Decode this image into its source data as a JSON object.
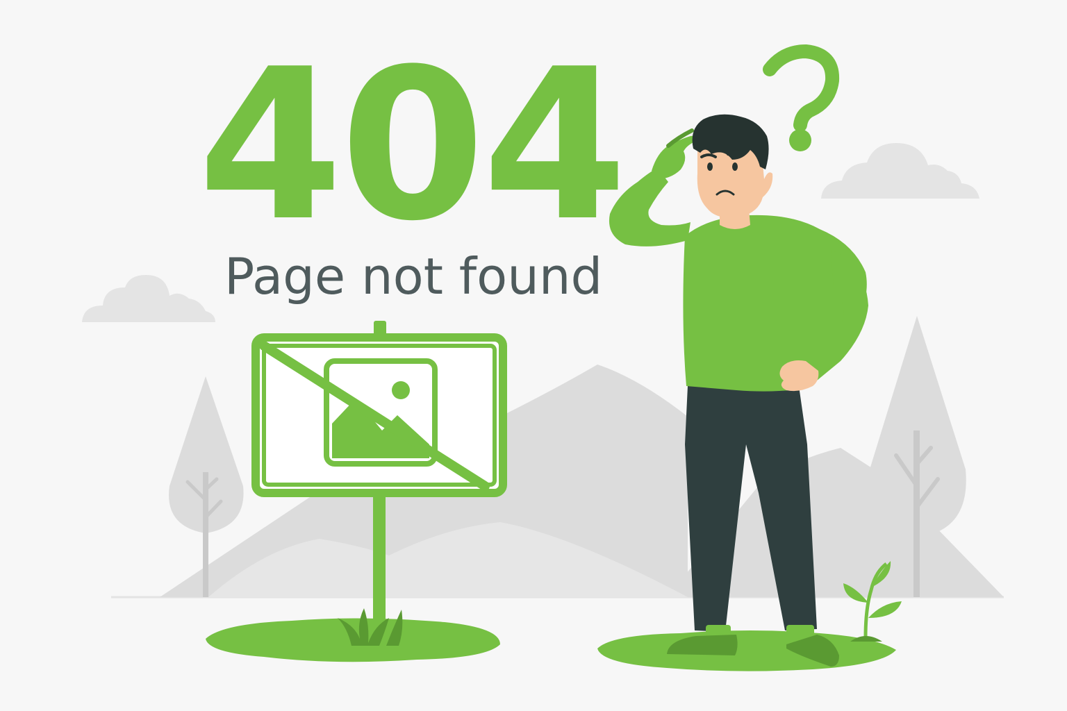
{
  "error": {
    "code": "404",
    "message": "Page not found"
  },
  "colors": {
    "accent_green": "#76c043",
    "dark_green": "#5a9a32",
    "text_gray": "#4f5b5d",
    "background": "#f7f7f7",
    "scenery_gray": "#dcdcdc",
    "pants": "#2f3f3f",
    "skin": "#f6c6a0",
    "hair": "#263330"
  },
  "illustration": {
    "icons": [
      "question-mark-icon",
      "broken-image-icon",
      "cloud-icon",
      "tree-icon",
      "mountain-icon",
      "sprout-icon"
    ]
  }
}
